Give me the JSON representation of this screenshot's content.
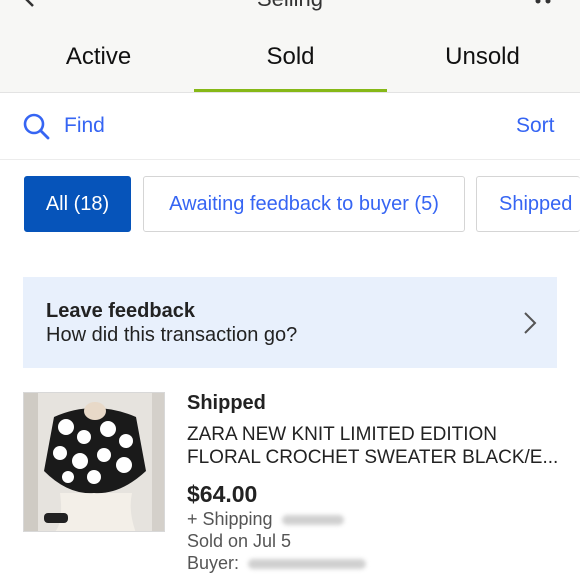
{
  "header": {
    "title": "Selling",
    "tabs": [
      {
        "label": "Active"
      },
      {
        "label": "Sold"
      },
      {
        "label": "Unsold"
      }
    ]
  },
  "find": {
    "label": "Find"
  },
  "sort": {
    "label": "Sort"
  },
  "filters": [
    {
      "label": "All (18)"
    },
    {
      "label": "Awaiting feedback to buyer (5)"
    },
    {
      "label": "Shipped"
    }
  ],
  "feedback": {
    "title": "Leave feedback",
    "subtitle": "How did this transaction go?"
  },
  "listing": {
    "status": "Shipped",
    "title_line1": "ZARA NEW KNIT LIMITED EDITION",
    "title_line2": "FLORAL CROCHET SWEATER BLACK/E...",
    "price": "$64.00",
    "shipping_label": "+ Shipping",
    "sold_on": "Sold on Jul 5",
    "buyer_label": "Buyer:"
  },
  "colors": {
    "accent": "#3665f3",
    "selected_chip": "#0654ba",
    "tab_indicator": "#86b817",
    "banner_bg": "#e8f0fc"
  }
}
